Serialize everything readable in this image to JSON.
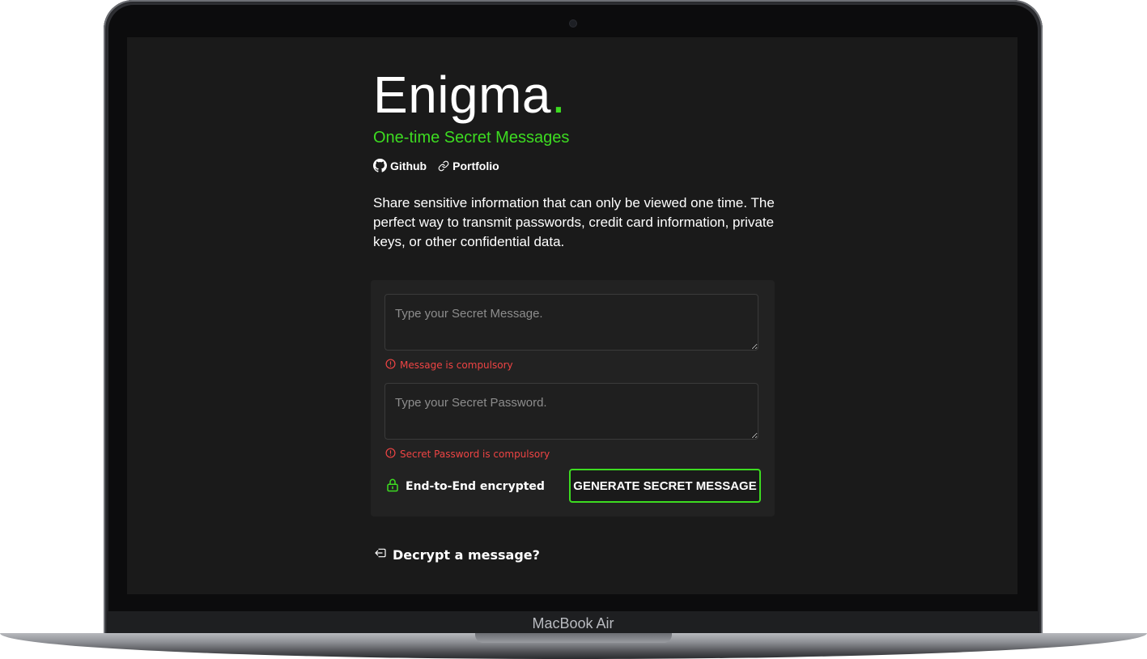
{
  "app": {
    "title": "Enigma",
    "title_dot": ".",
    "subtitle": "One-time Secret Messages",
    "accent_color": "#3ddc21",
    "error_color": "#ef4444"
  },
  "links": [
    {
      "label": "Github",
      "icon": "github-icon"
    },
    {
      "label": "Portfolio",
      "icon": "link-icon"
    }
  ],
  "description": "Share sensitive information that can only be viewed one time. The perfect way to transmit passwords, credit card information, private keys, or other confidential data.",
  "form": {
    "message_placeholder": "Type your Secret Message.",
    "message_value": "",
    "message_error": "Message is compulsory",
    "password_placeholder": "Type your Secret Password.",
    "password_value": "",
    "password_error": "Secret Password is compulsory",
    "encryption_label": "End-to-End encrypted",
    "encryption_icon": "lock-icon",
    "submit_label": "GENERATE SECRET MESSAGE"
  },
  "decrypt_link": {
    "label": "Decrypt a message?",
    "icon": "sign-in-icon"
  },
  "device": {
    "label": "MacBook Air"
  }
}
